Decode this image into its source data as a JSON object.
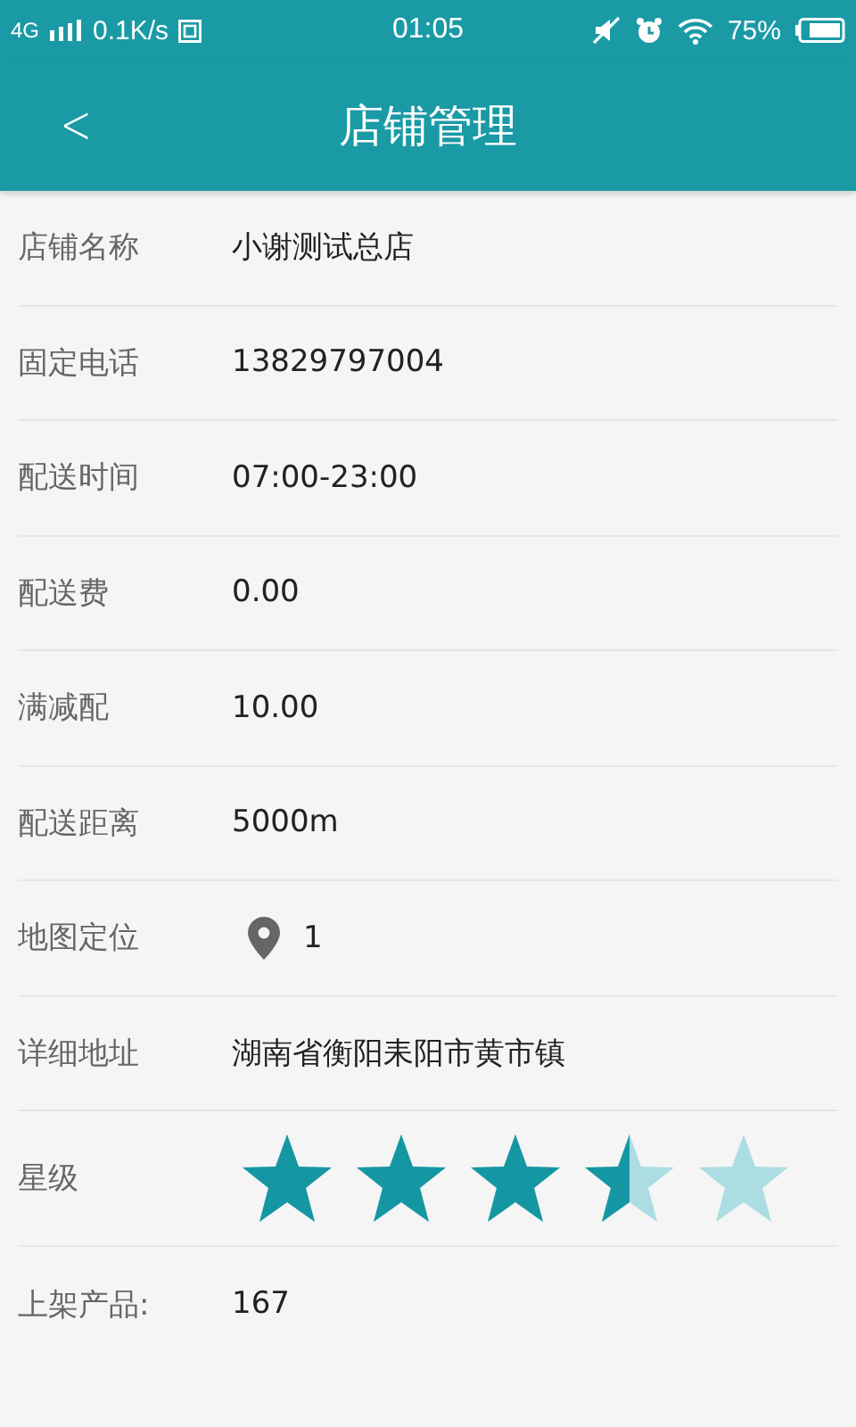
{
  "status_bar": {
    "network": "4G",
    "speed": "0.1K/s",
    "time": "01:05",
    "battery": "75%"
  },
  "header": {
    "back": "<",
    "title": "店铺管理"
  },
  "rows": [
    {
      "kind": "text",
      "label": "店铺名称",
      "value": "小谢测试总店"
    },
    {
      "kind": "text",
      "label": "固定电话",
      "value": "13829797004"
    },
    {
      "kind": "text",
      "label": "配送时间",
      "value": "07:00-23:00"
    },
    {
      "kind": "text",
      "label": "配送费",
      "value": "0.00"
    },
    {
      "kind": "text",
      "label": "满减配",
      "value": "10.00"
    },
    {
      "kind": "text",
      "label": "配送距离",
      "value": "5000m"
    },
    {
      "kind": "location",
      "label": "地图定位",
      "value": "1"
    },
    {
      "kind": "text",
      "label": "详细地址",
      "value": "湖南省衡阳耒阳市黄市镇"
    },
    {
      "kind": "stars",
      "label": "星级",
      "stars": 3.5
    },
    {
      "kind": "text",
      "label": "上架产品:",
      "value": "167"
    }
  ]
}
